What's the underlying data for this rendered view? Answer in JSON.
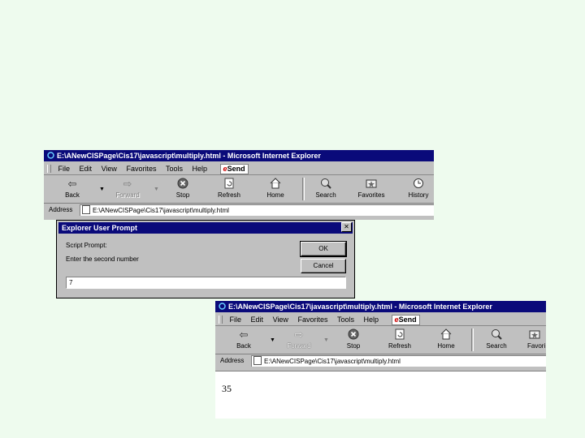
{
  "browser_window_1": {
    "title": "E:\\ANewCISPage\\Cis17\\javascript\\multiply.html - Microsoft Internet Explorer",
    "menu": [
      "File",
      "Edit",
      "View",
      "Favorites",
      "Tools",
      "Help"
    ],
    "send_label": "Send",
    "toolbar": {
      "back": "Back",
      "forward": "Forward",
      "stop": "Stop",
      "refresh": "Refresh",
      "home": "Home",
      "search": "Search",
      "favorites": "Favorites",
      "history": "History"
    },
    "address_label": "Address",
    "address_value": "E:\\ANewCISPage\\Cis17\\javascript\\multiply.html"
  },
  "dialog": {
    "title": "Explorer User Prompt",
    "script_prompt": "Script Prompt:",
    "message": "Enter the second number",
    "ok_label": "OK",
    "cancel_label": "Cancel",
    "input_value": "7"
  },
  "browser_window_2": {
    "title": "E:\\ANewCISPage\\Cis17\\javascript\\multiply.html - Microsoft Internet Explorer",
    "menu": [
      "File",
      "Edit",
      "View",
      "Favorites",
      "Tools",
      "Help"
    ],
    "send_label": "Send",
    "toolbar": {
      "back": "Back",
      "forward": "Forward",
      "stop": "Stop",
      "refresh": "Refresh",
      "home": "Home",
      "search": "Search",
      "favorites": "Favori"
    },
    "address_label": "Address",
    "address_value": "E:\\ANewCISPage\\Cis17\\javascript\\multiply.html",
    "result": "35"
  },
  "colors": {
    "background": "#eefbee",
    "titlebar": "#0a0a7a",
    "chrome": "#c0c0c0"
  }
}
